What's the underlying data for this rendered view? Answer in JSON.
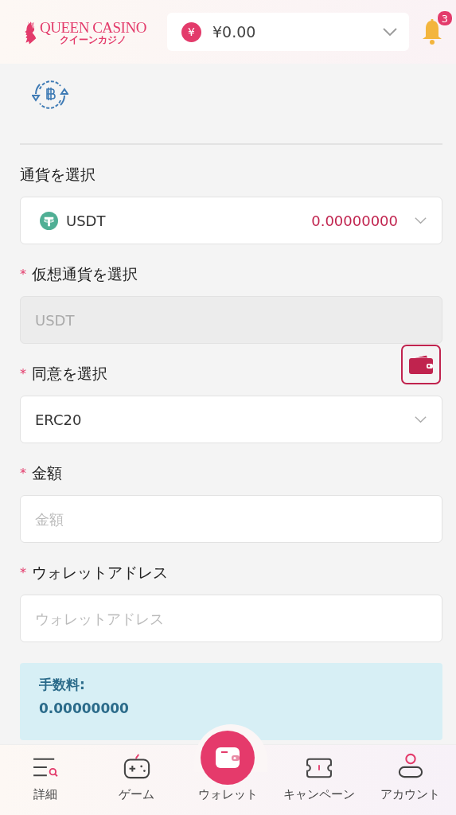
{
  "header": {
    "logo": {
      "title": "QUEEN CASINO",
      "subtitle": "クイーンカジノ"
    },
    "balance": {
      "currency_symbol": "¥",
      "amount": "¥0.00"
    },
    "notifications": {
      "count": "3"
    }
  },
  "form": {
    "fields": [
      {
        "kind": "currency-select",
        "label": "通貨を選択",
        "value": "USDT",
        "amount": "0.00000000"
      },
      {
        "kind": "readonly",
        "label": "仮想通貨を選択",
        "required_mark": "*",
        "value": "USDT"
      },
      {
        "kind": "select",
        "label": "同意を選択",
        "required_mark": "*",
        "value": "ERC20",
        "wallet_button": true
      },
      {
        "kind": "input",
        "label": "金額",
        "required_mark": "*",
        "placeholder": "金額"
      },
      {
        "kind": "input",
        "label": "ウォレットアドレス",
        "required_mark": "*",
        "placeholder": "ウォレットアドレス"
      }
    ],
    "fee": {
      "label": "手数料:",
      "value": "0.00000000"
    }
  },
  "nav": [
    {
      "kind": "menu",
      "label": "詳細",
      "selected": false
    },
    {
      "kind": "game",
      "label": "ゲーム",
      "selected": false
    },
    {
      "kind": "wallet",
      "label": "ウォレット",
      "selected": true
    },
    {
      "kind": "campaign",
      "label": "キャンペーン",
      "selected": false
    },
    {
      "kind": "account",
      "label": "アカウント",
      "selected": false
    }
  ]
}
